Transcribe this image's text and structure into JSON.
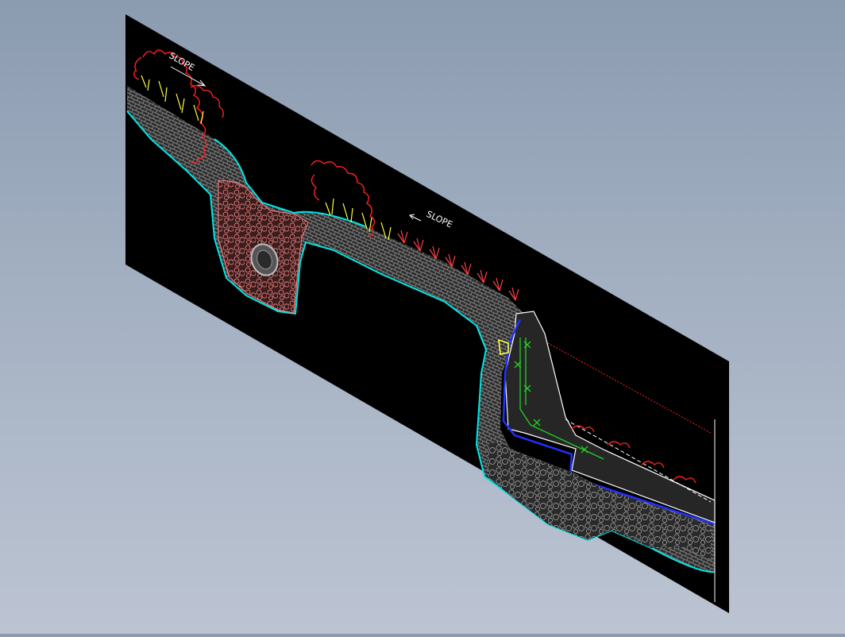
{
  "drawing": {
    "annotations": [
      {
        "text": "SLOPE",
        "direction": "right"
      },
      {
        "text": "SLOPE",
        "direction": "left"
      }
    ]
  },
  "colors": {
    "background_top": "#8b9bb0",
    "background_bottom": "#bcc4d2",
    "sheet": "#000000",
    "soil_fill": "#3a3a3a",
    "soil_outline": "#00e5e5",
    "gravel": "#ff8080",
    "gravel_fill": "#5a2a2a",
    "shrub": "#ff2020",
    "grass": "#ffff40",
    "rebar": "#20d020",
    "liner": "#2030ff",
    "pipe": "#c0c0c0",
    "text": "#ffffff"
  }
}
